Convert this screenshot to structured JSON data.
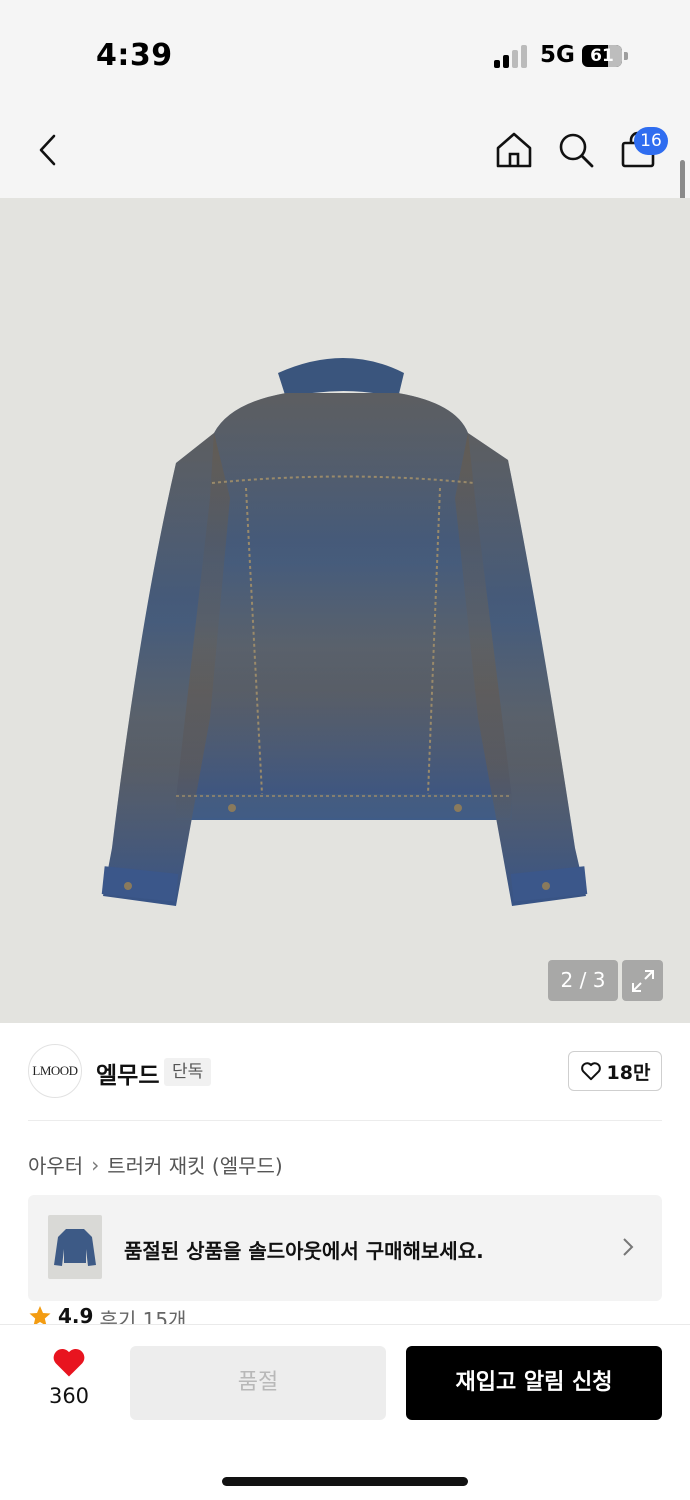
{
  "status_bar": {
    "time": "4:39",
    "network": "5G",
    "battery": "61"
  },
  "header": {
    "back_icon": "chevron-left-icon",
    "home_icon": "home-icon",
    "search_icon": "search-icon",
    "cart_icon": "shopping-bag-icon",
    "cart_count": "16"
  },
  "gallery": {
    "counter": "2 / 3",
    "expand_icon": "expand-icon"
  },
  "brand": {
    "logo_text": "LMOOD",
    "name": "엘무드",
    "tag": "단독",
    "like_count": "18만"
  },
  "breadcrumb": {
    "category": "아우터",
    "product": "트러커 재킷 (엘무드)"
  },
  "banner": {
    "text": "품절된 상품을 솔드아웃에서 구매해보세요."
  },
  "rating": {
    "score": "4.9",
    "reviews": "후기 15개"
  },
  "bottom_bar": {
    "wish_count": "360",
    "soldout_label": "품절",
    "restock_label": "재입고 알림 신청"
  },
  "colors": {
    "accent_badge": "#2f6df0",
    "wish_heart": "#e8141f",
    "cta": "#000000",
    "star": "#f39c12"
  }
}
